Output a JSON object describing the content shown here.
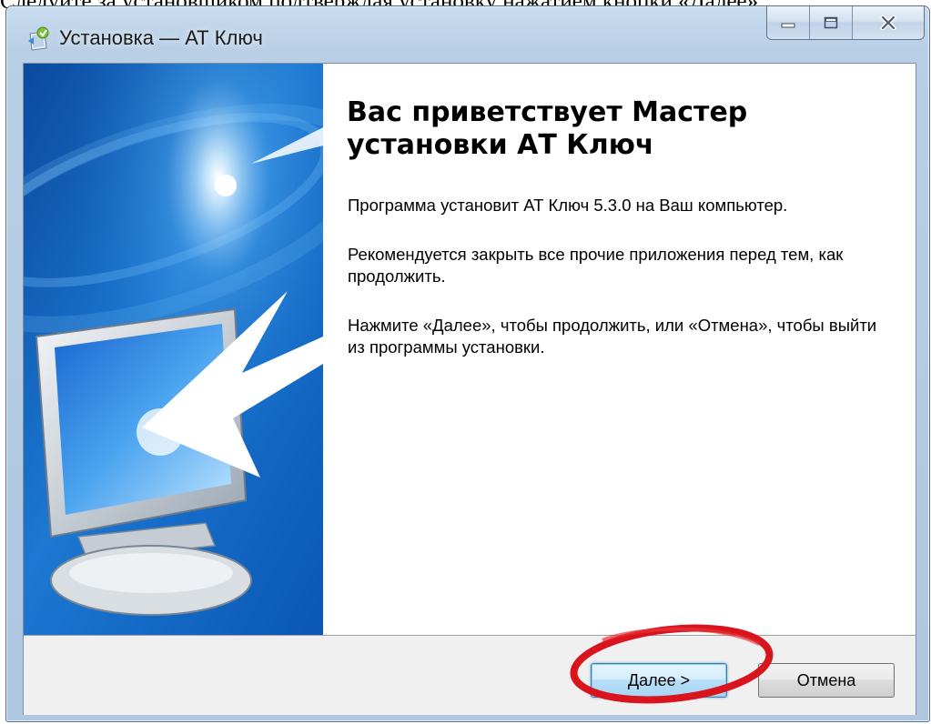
{
  "document": {
    "caption": "Следуйте за установщиком подтверждая установку нажатием кнопки «Далее»"
  },
  "window": {
    "title": "Установка — АТ Ключ",
    "controls": {
      "minimize_icon": "minimize-icon",
      "maximize_icon": "maximize-icon",
      "close_icon": "close-icon"
    }
  },
  "wizard": {
    "heading": "Вас приветствует Мастер установки АТ Ключ",
    "paragraph1": "Программа установит АТ Ключ 5.3.0 на Ваш компьютер.",
    "paragraph2": "Рекомендуется закрыть все прочие приложения перед тем, как продолжить.",
    "paragraph3": "Нажмите «Далее», чтобы продолжить, или «Отмена», чтобы выйти из программы установки."
  },
  "buttons": {
    "next": "Далее >",
    "cancel": "Отмена"
  },
  "colors": {
    "banner_blue": "#1a6fc4",
    "highlight_red": "#d8141c"
  }
}
